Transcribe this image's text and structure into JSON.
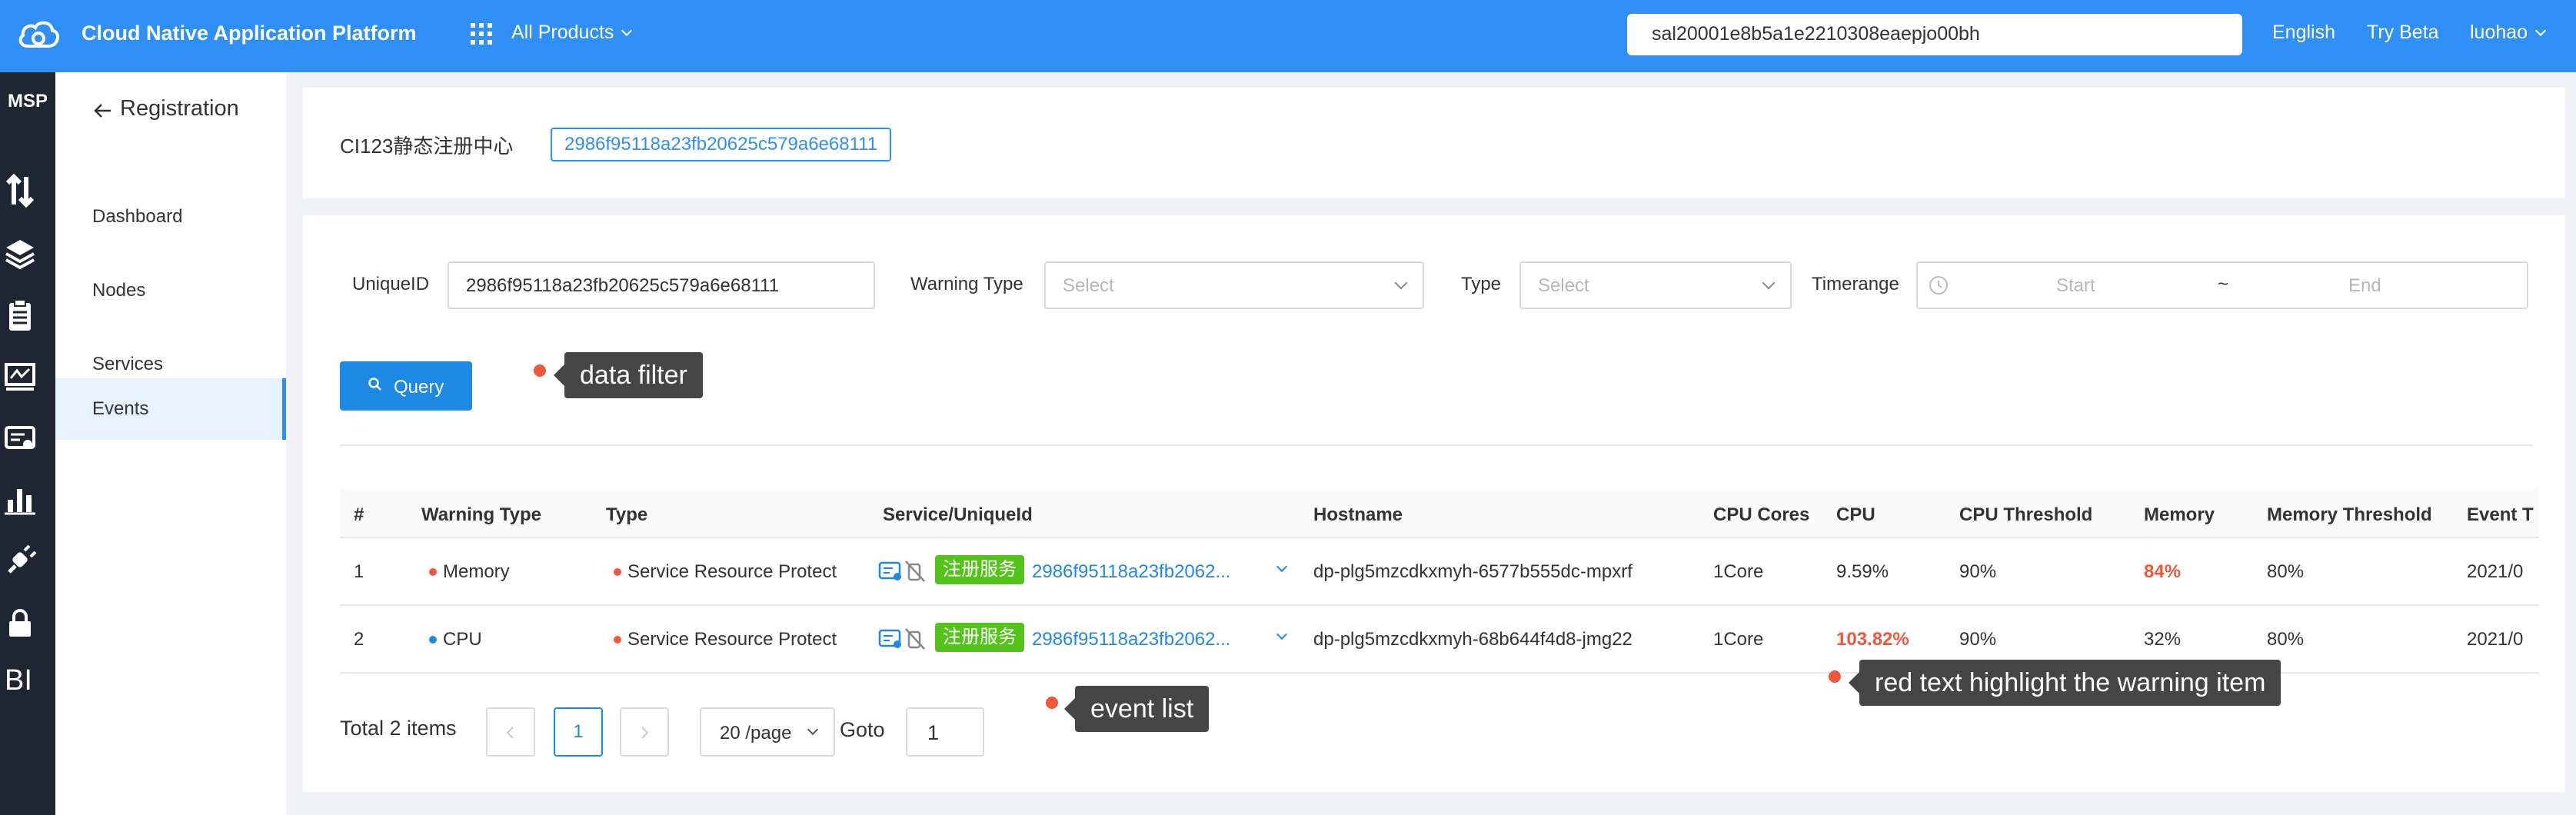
{
  "topbar": {
    "app_title": "Cloud Native Application Platform",
    "products_label": "All Products",
    "search_value": "sal20001e8b5a1e2210308eaepjo00bh",
    "language": "English",
    "try_beta": "Try Beta",
    "user": "luohao",
    "bg_color": "#2f8ff5"
  },
  "rail": {
    "title": "MSP",
    "icons": [
      "transfer-icon",
      "layers-icon",
      "clipboard-icon",
      "monitor-icon",
      "certificate-icon",
      "bar-chart-icon",
      "plug-icon",
      "lock-icon"
    ],
    "bi_label": "BI"
  },
  "subnav": {
    "back_label": "Registration",
    "items": [
      {
        "label": "Dashboard"
      },
      {
        "label": "Nodes"
      },
      {
        "label": "Services"
      },
      {
        "label": "Events"
      }
    ],
    "active": "Events"
  },
  "header": {
    "registry_name": "CI123静态注册中心",
    "registry_id": "2986f95118a23fb20625c579a6e68111"
  },
  "filters": {
    "unique_id_label": "UniqueID",
    "unique_id_value": "2986f95118a23fb20625c579a6e68111",
    "warning_type_label": "Warning Type",
    "warning_type_placeholder": "Select",
    "type_label": "Type",
    "type_placeholder": "Select",
    "timerange_label": "Timerange",
    "start_placeholder": "Start",
    "separator": "~",
    "end_placeholder": "End",
    "query_label": "Query"
  },
  "table": {
    "headers": [
      "#",
      "Warning Type",
      "Type",
      "Service/UniqueId",
      "Hostname",
      "CPU Cores",
      "CPU",
      "CPU Threshold",
      "Memory",
      "Memory Threshold",
      "Event T"
    ],
    "rows": [
      {
        "index": "1",
        "warning_type": "Memory",
        "warning_color": "#f0573a",
        "type": "Service Resource Protect",
        "type_color": "#f0573a",
        "service_tag": "注册服务",
        "unique_id": "2986f95118a23fb2062...",
        "hostname": "dp-plg5mzcdkxmyh-6577b555dc-mpxrf",
        "cpu_cores": "1Core",
        "cpu": "9.59%",
        "cpu_threshold": "90%",
        "memory": "84%",
        "memory_threshold": "80%",
        "event_time": "2021/0",
        "highlight": "memory"
      },
      {
        "index": "2",
        "warning_type": "CPU",
        "warning_color": "#1e88e5",
        "type": "Service Resource Protect",
        "type_color": "#f0573a",
        "service_tag": "注册服务",
        "unique_id": "2986f95118a23fb2062...",
        "hostname": "dp-plg5mzcdkxmyh-68b644f4d8-jmg22",
        "cpu_cores": "1Core",
        "cpu": "103.82%",
        "cpu_threshold": "90%",
        "memory": "32%",
        "memory_threshold": "80%",
        "event_time": "2021/0",
        "highlight": "cpu"
      }
    ]
  },
  "pagination": {
    "total": "Total 2 items",
    "current_page": "1",
    "page_size": "20 /page",
    "goto_label": "Goto",
    "goto_value": "1"
  },
  "annotations": {
    "filter": "data filter",
    "list": "event list",
    "highlight": "red text highlight the warning item"
  }
}
